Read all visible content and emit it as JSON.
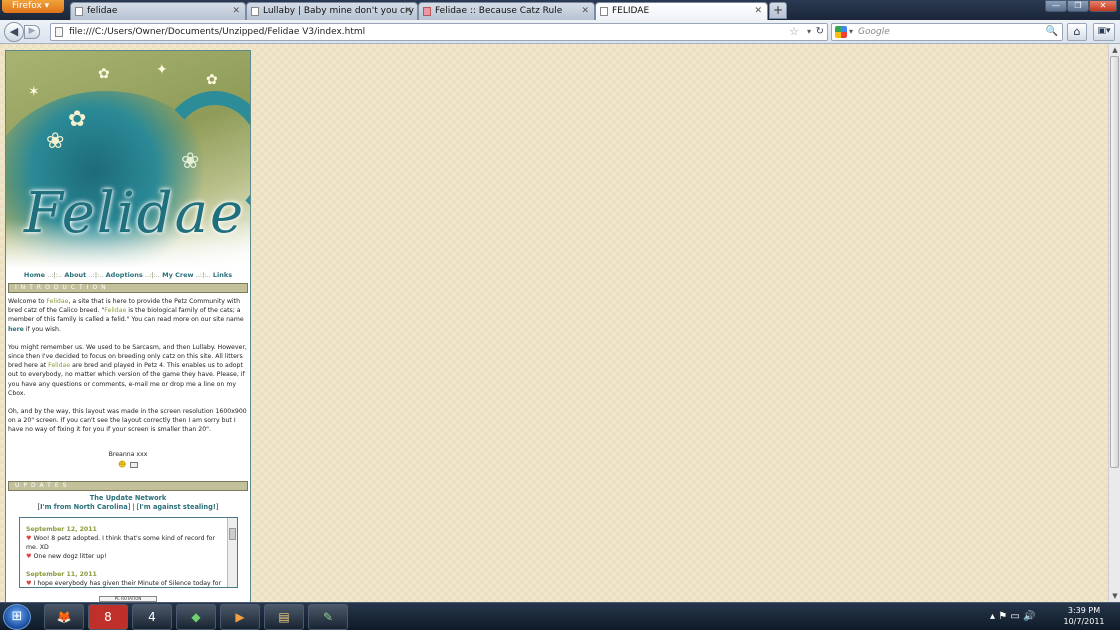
{
  "browser": {
    "firefox_button": "Firefox",
    "tabs": [
      {
        "label": "felidae"
      },
      {
        "label": "Lullaby | Baby mine don't you cry"
      },
      {
        "label": "Felidae :: Because Catz Rule"
      },
      {
        "label": "FELIDAE"
      }
    ],
    "new_tab": "+",
    "url": "file:///C:/Users/Owner/Documents/Unzipped/Felidae V3/index.html",
    "search_placeholder": "Google"
  },
  "site": {
    "logo": "Felidae",
    "nav": [
      "Home",
      "About",
      "Adoptions",
      "My Crew",
      "Links"
    ],
    "nav_sep": "..:|:..",
    "intro_header": "INTRODUCTION",
    "intro": {
      "p1_a": "Welcome to ",
      "p1_b": "Felidae",
      "p1_c": ", a site that is here to provide the Petz Community with bred catz of the Calico breed. \"",
      "p1_d": "Felidae",
      "p1_e": " is the biological family of the cats; a member of this family is called a felid.\" You can read more on our site name ",
      "p1_f": "here",
      "p1_g": " if you wish.",
      "p2_a": "You might remember us. We used to be Sarcasm, and then Lullaby. However, since then I've decided to focus on breeding only catz on this site. All litters bred here at ",
      "p2_b": "Felidae",
      "p2_c": " are bred and played in Petz 4. This enables us to adopt out to everybody, no matter which version of the game they have. Please, if you have any questions or comments, e-mail me or drop me a line on my Cbox.",
      "p3": "Oh, and by the way, this layout was made in the screen resolution 1600x900 on a 20\" screen. If you can't see the layout correctly then I am sorry but I have no way of fixing it for you if your screen is smaller than 20\"."
    },
    "signature": "Breanna xxx",
    "updates_header": "UPDATES",
    "update_network": "The Update Network",
    "update_links": {
      "open1": "[",
      "l1": "I'm from North Carolina",
      "mid": "] | [",
      "l2": "I'm against stealing!",
      "close": "]"
    },
    "updates": [
      {
        "date": "September 12, 2011",
        "items": [
          "Woo! 8 petz adopted. I think that's some kind of record for me. XD",
          "One new dogz litter up!"
        ]
      },
      {
        "date": "September 11, 2011",
        "items": [
          "I hope everybody has given their Minute of Silence today for"
        ]
      }
    ],
    "pc_rotation": "PC ROTATION"
  },
  "taskbar": {
    "apps": [
      "firefox",
      "psp8",
      "petz4",
      "sims",
      "media-player",
      "explorer",
      "notepad"
    ],
    "clock_time": "3:39 PM",
    "clock_date": "10/7/2011"
  }
}
